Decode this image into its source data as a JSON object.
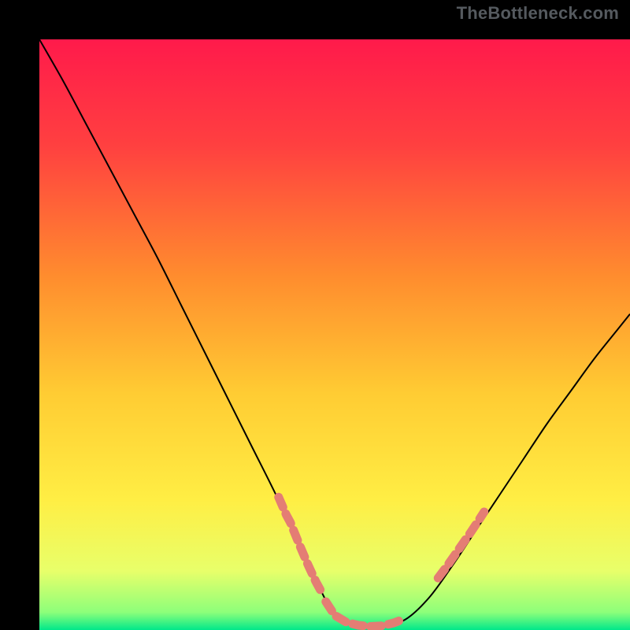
{
  "watermark": "TheBottleneck.com",
  "chart_data": {
    "type": "line",
    "title": "",
    "xlabel": "",
    "ylabel": "",
    "xlim": [
      0,
      100
    ],
    "ylim": [
      0,
      100
    ],
    "grid": false,
    "legend": false,
    "background_gradient": {
      "stops": [
        {
          "offset": 0.0,
          "color": "#ff1a4b"
        },
        {
          "offset": 0.18,
          "color": "#ff4040"
        },
        {
          "offset": 0.4,
          "color": "#ff8c2e"
        },
        {
          "offset": 0.6,
          "color": "#ffcc33"
        },
        {
          "offset": 0.78,
          "color": "#ffee44"
        },
        {
          "offset": 0.9,
          "color": "#e8ff6a"
        },
        {
          "offset": 0.97,
          "color": "#8dff7a"
        },
        {
          "offset": 1.0,
          "color": "#00e88a"
        }
      ]
    },
    "series": [
      {
        "name": "bottleneck-curve",
        "color": "#000000",
        "x": [
          0,
          4,
          8,
          12,
          16,
          20,
          24,
          28,
          32,
          36,
          40,
          44,
          48,
          50,
          52,
          55,
          58,
          62,
          66,
          70,
          74,
          78,
          82,
          86,
          90,
          94,
          98,
          100
        ],
        "y": [
          100,
          93,
          85.5,
          78,
          70.5,
          63,
          55,
          47,
          39,
          31,
          23,
          14.5,
          6,
          2.5,
          1.2,
          0.6,
          0.6,
          1.8,
          5.5,
          11,
          17,
          23,
          29,
          35,
          40.5,
          46,
          51,
          53.5
        ]
      }
    ],
    "marker_segments": [
      {
        "name": "left-transition",
        "color": "#e47d74",
        "width": 11,
        "points": [
          [
            40.5,
            22.5
          ],
          [
            41.8,
            19.5
          ],
          [
            42.5,
            18.2
          ],
          [
            44.0,
            14.5
          ],
          [
            45.5,
            11.0
          ],
          [
            46.8,
            8.2
          ],
          [
            48.0,
            6.0
          ]
        ]
      },
      {
        "name": "bottom-flat",
        "color": "#e47d74",
        "width": 11,
        "points": [
          [
            48.5,
            4.8
          ],
          [
            50.0,
            2.5
          ],
          [
            52.0,
            1.3
          ],
          [
            54.0,
            0.8
          ],
          [
            56.0,
            0.6
          ],
          [
            58.0,
            0.7
          ],
          [
            60.0,
            1.2
          ],
          [
            61.8,
            1.9
          ]
        ]
      },
      {
        "name": "right-transition",
        "color": "#e47d74",
        "width": 11,
        "points": [
          [
            67.5,
            8.8
          ],
          [
            69.0,
            10.8
          ],
          [
            70.2,
            12.5
          ],
          [
            71.8,
            14.8
          ],
          [
            73.0,
            16.5
          ],
          [
            74.2,
            18.3
          ],
          [
            75.3,
            20.0
          ]
        ]
      }
    ]
  }
}
